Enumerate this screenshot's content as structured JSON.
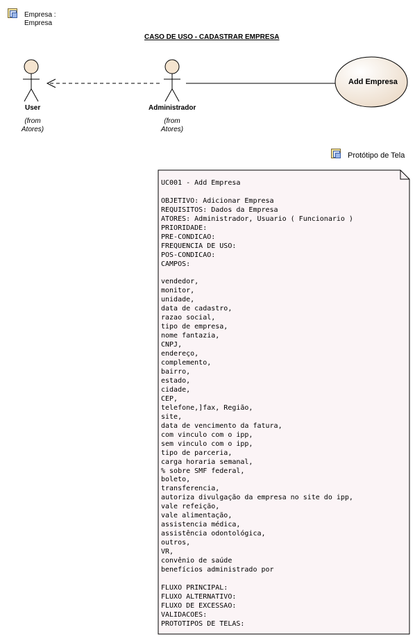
{
  "package_link_top": {
    "line1": "Empresa :",
    "line2": "Empresa"
  },
  "diagram_title": "CASO DE USO - CADASTRAR EMPRESA",
  "actors": [
    {
      "name": "User",
      "from_line1": "(from",
      "from_line2": "Atores)"
    },
    {
      "name": "Administrador",
      "from_line1": "(from",
      "from_line2": "Atores)"
    }
  ],
  "use_case": {
    "name": "Add Empresa"
  },
  "prototype_link": {
    "label": "Protótipo de Tela"
  },
  "note": {
    "lines": [
      "UC001 - Add Empresa",
      "",
      "OBJETIVO: Adicionar Empresa",
      "REQUISITOS: Dados da Empresa",
      "ATORES: Administrador, Usuario ( Funcionario )",
      "PRIORIDADE:",
      "PRE-CONDICAO:",
      "FREQUENCIA DE USO:",
      "POS-CONDICAO:",
      "CAMPOS:",
      "",
      "vendedor,",
      "monitor,",
      "unidade,",
      "data de cadastro,",
      "razao social,",
      "tipo de empresa,",
      "nome fantazia,",
      "CNPJ,",
      "endereço,",
      "complemento,",
      "bairro,",
      "estado,",
      "cidade,",
      "CEP,",
      "telefone,]fax, Região,",
      "site,",
      "data de vencimento da fatura,",
      "com vinculo com o ipp,",
      "sem vinculo com o ipp,",
      "tipo de parceria,",
      "carga horaria semanal,",
      "% sobre SMF federal,",
      "boleto,",
      "transferencia,",
      "autoriza divulgação da empresa no site do ipp,",
      "vale refeição,",
      "vale alimentação,",
      "assistencia médica,",
      "assistência odontológica,",
      "outros,",
      "VR,",
      "convênio de saúde",
      "benefícios administrado por",
      "",
      "FLUXO PRINCIPAL:",
      "FLUXO ALTERNATIVO:",
      "FLUXO DE EXCESSAO:",
      "VALIDACOES:",
      "PROTOTIPOS DE TELAS:"
    ]
  },
  "colors": {
    "actor_head": "#f5e4cf",
    "use_case_fill_light": "#ffffff",
    "use_case_fill_dark": "#ecdcca",
    "note_fill": "#fbf4f6",
    "stroke": "#000000"
  }
}
